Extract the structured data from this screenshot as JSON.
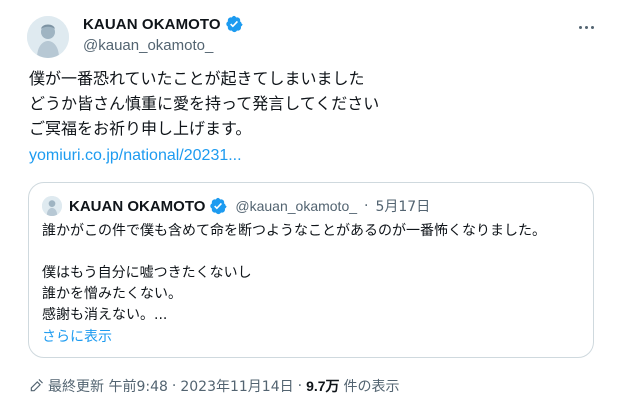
{
  "author": {
    "display_name": "KAUAN OKAMOTO",
    "handle": "@kauan_okamoto_",
    "verified_icon": "verified-badge-icon",
    "more_icon": "more-options-icon"
  },
  "tweet": {
    "lines": [
      "僕が一番恐れていたことが起きてしまいました",
      "どうか皆さん慎重に愛を持って発言してください",
      "ご冥福をお祈り申し上げます。"
    ],
    "link": "yomiuri.co.jp/national/20231..."
  },
  "quote": {
    "display_name": "KAUAN OKAMOTO",
    "handle": "@kauan_okamoto_",
    "separator": "·",
    "date": "5月17日",
    "lines": [
      "誰かがこの件で僕も含めて命を断つようなことがあるのが一番怖くなりました。",
      "",
      "僕はもう自分に嘘つきたくないし",
      "誰かを憎みたくない。",
      "感謝も消えない。..."
    ],
    "show_more": "さらに表示"
  },
  "footer": {
    "edit_icon": "pencil-icon",
    "last_edited": "最終更新 午前9:48",
    "separator1": "·",
    "date": "2023年11月14日",
    "separator2": "·",
    "views_count": "9.7万",
    "views_label": "件の表示"
  },
  "colors": {
    "link": "#1d9bf0",
    "verified": "#1d9bf0",
    "secondary_text": "#536471",
    "border": "#cfd9de"
  }
}
